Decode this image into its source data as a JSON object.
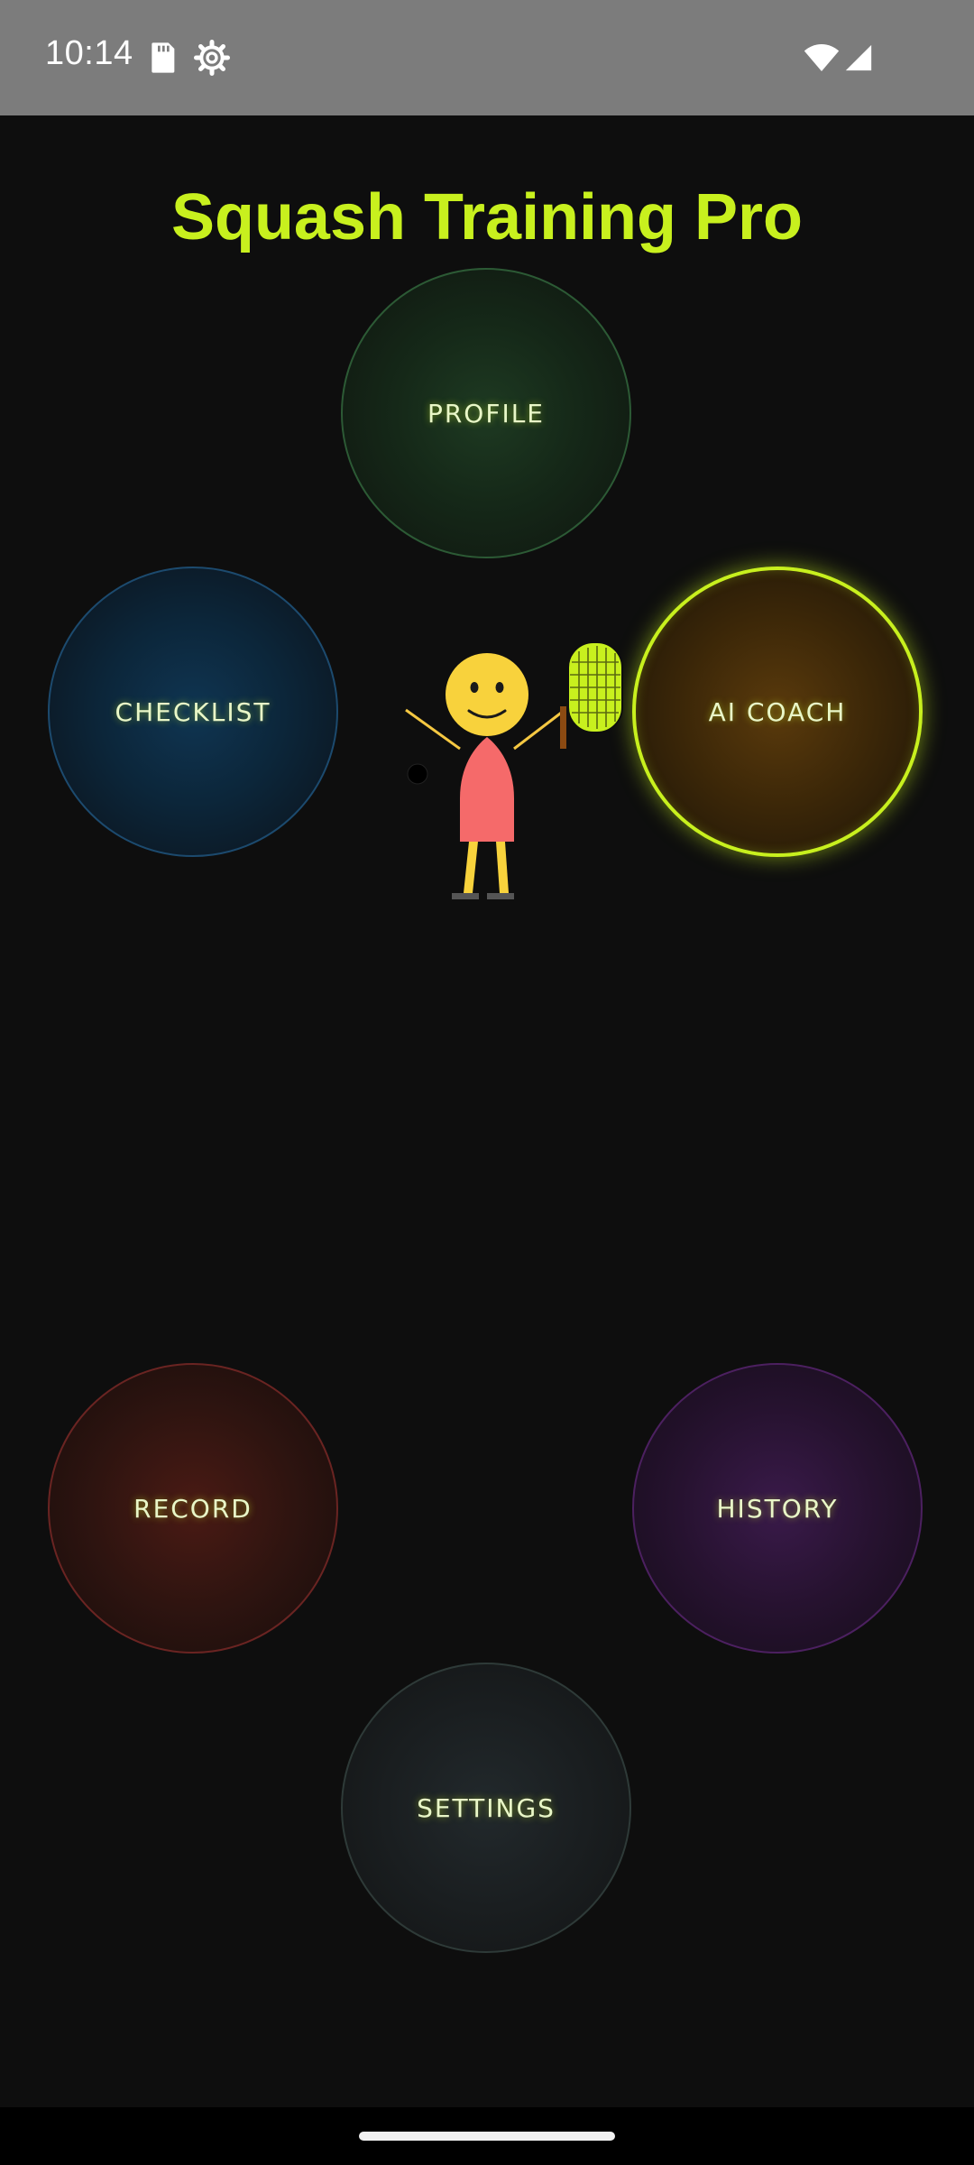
{
  "status_bar": {
    "time": "10:14",
    "icons": [
      "sd-card-icon",
      "settings-gear-icon",
      "wifi-icon",
      "cell-signal-icon"
    ]
  },
  "app": {
    "title": "Squash Training Pro",
    "accent_color": "#c8f01e"
  },
  "menu": {
    "profile": "PROFILE",
    "checklist": "CHECKLIST",
    "ai_coach": "AI COACH",
    "record": "RECORD",
    "history": "HISTORY",
    "settings": "SETTINGS"
  },
  "mascot": {
    "icon": "squash-player-mascot-icon"
  }
}
